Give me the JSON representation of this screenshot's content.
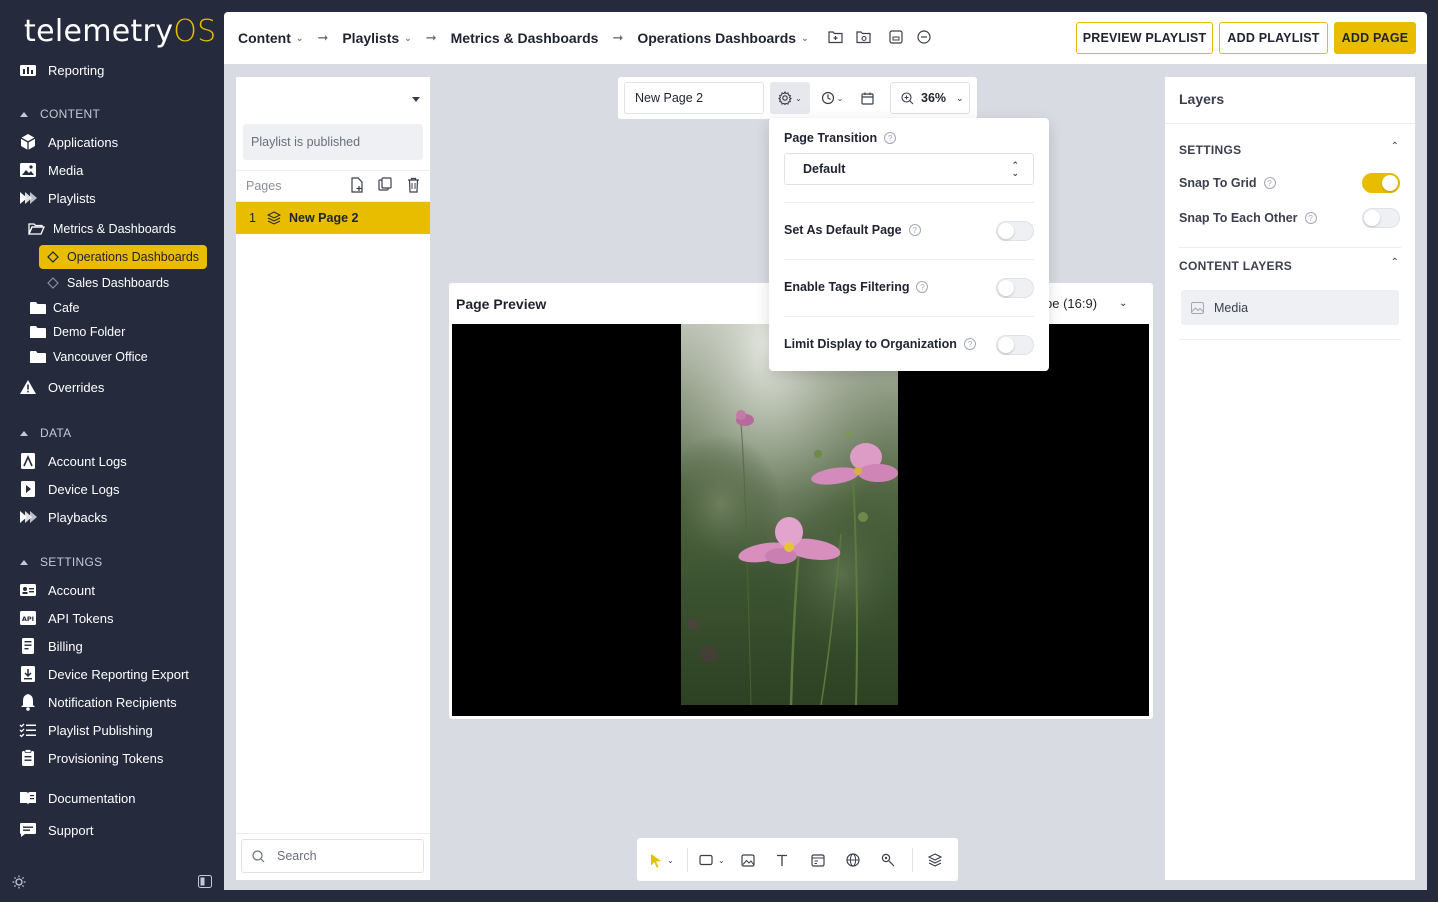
{
  "brand": {
    "name_main": "telemetry",
    "name_accent": "OS",
    "accent_color": "#e8bd00"
  },
  "sidebar": {
    "reporting_label": "Reporting",
    "content_section": "CONTENT",
    "content_items": [
      {
        "label": "Applications",
        "icon": "applications-icon"
      },
      {
        "label": "Media",
        "icon": "media-icon"
      },
      {
        "label": "Playlists",
        "icon": "playlists-icon"
      }
    ],
    "folder_tree": {
      "parent": "Metrics & Dashboards",
      "children": [
        "Operations Dashboards",
        "Sales Dashboards"
      ],
      "folders": [
        "Cafe",
        "Demo Folder",
        "Vancouver Office"
      ]
    },
    "overrides_label": "Overrides",
    "data_section": "DATA",
    "data_items": [
      {
        "label": "Account Logs"
      },
      {
        "label": "Device Logs"
      },
      {
        "label": "Playbacks"
      }
    ],
    "settings_section": "SETTINGS",
    "settings_items": [
      {
        "label": "Account"
      },
      {
        "label": "API Tokens"
      },
      {
        "label": "Billing"
      },
      {
        "label": "Device Reporting Export"
      },
      {
        "label": "Notification Recipients"
      },
      {
        "label": "Playlist Publishing"
      },
      {
        "label": "Provisioning Tokens"
      }
    ],
    "documentation_label": "Documentation",
    "support_label": "Support"
  },
  "header": {
    "breadcrumbs": [
      "Content",
      "Playlists",
      "Metrics & Dashboards",
      "Operations Dashboards"
    ],
    "preview_playlist": "PREVIEW PLAYLIST",
    "add_playlist": "ADD PLAYLIST",
    "add_page": "ADD PAGE"
  },
  "left_panel": {
    "status": "Playlist is published",
    "pages_label": "Pages",
    "pages": [
      {
        "index": "1",
        "name": "New Page 2"
      }
    ],
    "search_placeholder": "Search"
  },
  "page_toolbar": {
    "page_name": "New Page 2",
    "zoom": "36%"
  },
  "settings_popup": {
    "page_transition_label": "Page Transition",
    "page_transition_value": "Default",
    "set_default_label": "Set As Default Page",
    "set_default_on": false,
    "tags_filter_label": "Enable Tags Filtering",
    "tags_filter_on": false,
    "limit_org_label": "Limit Display to Organization",
    "limit_org_on": false
  },
  "preview": {
    "title": "Page Preview",
    "aspect_visible": "pe (16:9)"
  },
  "right_panel": {
    "title": "Layers",
    "settings_section": "SETTINGS",
    "snap_grid_label": "Snap To Grid",
    "snap_grid_on": true,
    "snap_each_label": "Snap To Each Other",
    "snap_each_on": false,
    "content_layers_section": "CONTENT LAYERS",
    "layers": [
      {
        "name": "Media"
      }
    ]
  }
}
